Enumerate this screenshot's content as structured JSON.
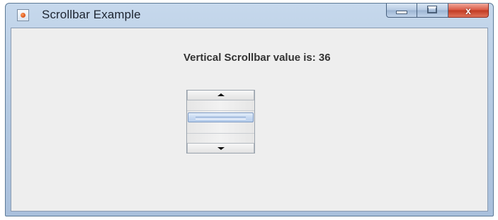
{
  "window": {
    "title": "Scrollbar Example",
    "icon": "java-app-icon",
    "caption_buttons": [
      "minimize",
      "maximize",
      "close"
    ],
    "close_glyph": "x"
  },
  "content": {
    "label_text": "Vertical Scrollbar value is: 36"
  },
  "scrollbar": {
    "orientation": "vertical",
    "value": 36,
    "min": 0,
    "max": 100,
    "thumb_fraction": 0.36
  },
  "colors": {
    "client_bg": "#eeeeee",
    "label_text": "#333333",
    "thumb_accent": "#b9cfec",
    "close_button": "#c03a22"
  }
}
